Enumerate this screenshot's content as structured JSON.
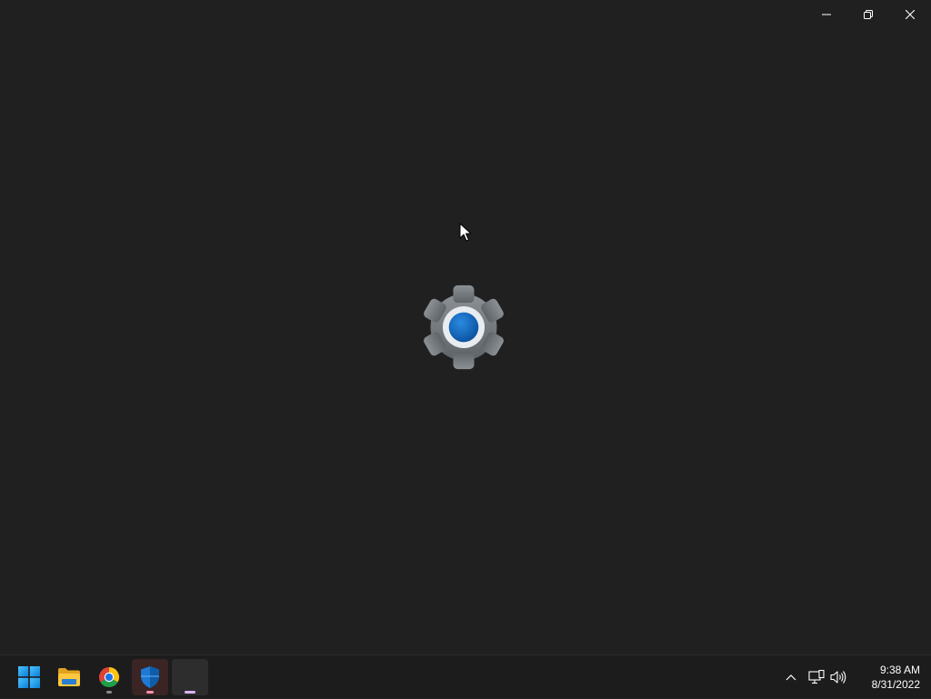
{
  "window": {
    "caption_buttons": [
      {
        "name": "minimize-icon"
      },
      {
        "name": "restore-icon"
      },
      {
        "name": "close-icon"
      }
    ],
    "splash_icon": "settings-gear-icon"
  },
  "taskbar": {
    "apps": [
      {
        "name": "start-button",
        "icon": "windows-logo-icon"
      },
      {
        "name": "file-explorer-button",
        "icon": "folder-icon"
      },
      {
        "name": "chrome-button",
        "icon": "chrome-icon"
      },
      {
        "name": "windows-security-button",
        "icon": "shield-icon"
      },
      {
        "name": "settings-app-button",
        "icon": "blank-app-icon"
      }
    ],
    "tray": {
      "icons": [
        "chevron-up-icon",
        "network-icon",
        "volume-icon"
      ],
      "time": "9:38 AM",
      "date": "8/31/2022"
    }
  },
  "colors": {
    "background": "#202020",
    "taskbar": "#1c1c1c",
    "accent": "#0f6cbd"
  }
}
